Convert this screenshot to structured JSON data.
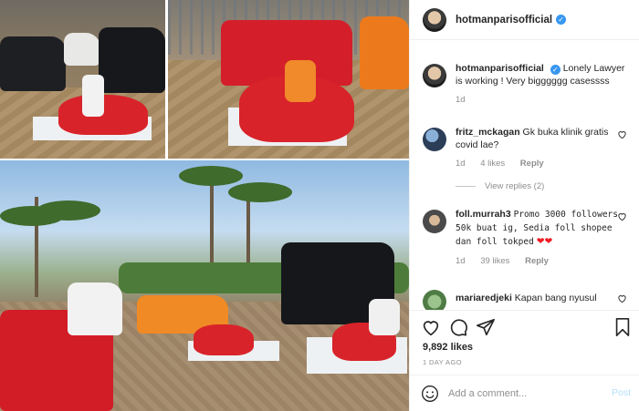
{
  "post": {
    "username": "hotmanparisofficial",
    "verified": true,
    "photo_alt": "Collage of a lawyer working on red beanbags beside luxury cars"
  },
  "caption": {
    "username": "hotmanparisofficial",
    "text": "Lonely Lawyer is working ! Very bigggggg casessss",
    "time": "1d"
  },
  "comments": [
    {
      "username": "fritz_mckagan",
      "text": "Gk buka klinik gratis covid lae?",
      "time": "1d",
      "likes": "4 likes",
      "reply": "Reply",
      "view_replies": "View replies (2)"
    },
    {
      "username": "foll.murrah3",
      "text": "Promo 3000 followers 50k buat ig, Sedia foll shopee dan foll tokped",
      "emoji": "❤❤",
      "time": "1d",
      "likes": "39 likes",
      "reply": "Reply"
    },
    {
      "username": "mariaredjeki",
      "text": "Kapan bang nyusul"
    }
  ],
  "stats": {
    "likes": "9,892 likes",
    "time_ago": "1 DAY AGO"
  },
  "composer": {
    "placeholder": "Add a comment...",
    "post_label": "Post"
  },
  "colors": {
    "verified": "#3897f0",
    "muted": "#8e8e8e",
    "post_disabled": "#b2dffc"
  }
}
